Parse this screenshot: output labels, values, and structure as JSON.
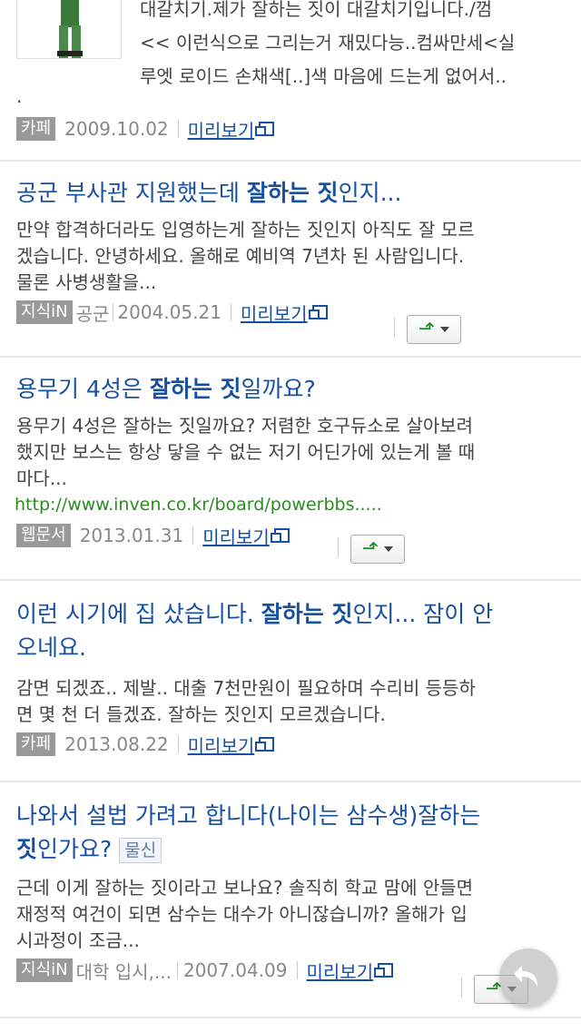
{
  "results": [
    {
      "desc_lines": [
        "대갈치기.제가 잘하는 짓이 대갈치기입니다./껌",
        "<< 이런식으로 그리는거 재밌다능..컴싸만세<실",
        "루엣 로이드 손채색[..]색 마음에 드는게 없어서.."
      ],
      "desc_tail": ".",
      "source": "카페",
      "date": "2009.10.02",
      "preview": "미리보기"
    },
    {
      "title_pre": "공군 부사관 지원했는데 ",
      "title_bold": "잘하는 짓",
      "title_post": "인지...",
      "desc_lines": [
        "만약 합격하더라도 입영하는게 잘하는 짓인지 아직도 잘 모르",
        "겠습니다. 안녕하세요. 올해로 예비역 7년차 된 사람입니다.",
        "물론 사병생활을..."
      ],
      "source": "지식iN",
      "category": "공군",
      "date": "2004.05.21",
      "preview": "미리보기"
    },
    {
      "title_pre": "용무기 4성은 ",
      "title_bold": "잘하는 짓",
      "title_post": "일까요?",
      "desc_lines": [
        "용무기 4성은 잘하는 짓일까요? 저렴한 호구듀소로 살아보려",
        "했지만 보스는 항상 닿을 수 없는 저기 어딘가에 있는게 볼 때",
        "마다..."
      ],
      "url": "http://www.inven.co.kr/board/powerbbs.....",
      "source": "웹문서",
      "date": "2013.01.31",
      "preview": "미리보기"
    },
    {
      "title_pre": "이런 시기에 집 샀습니다. ",
      "title_bold": "잘하는 짓",
      "title_post": "인지... 잠이 안",
      "title_line2": "오네요.",
      "desc_lines": [
        "감면 되겠죠.. 제발.. 대출 7천만원이 필요하며 수리비 등등하",
        "면 몇 천 더 들겠죠. 잘하는 짓인지 모르겠습니다."
      ],
      "source": "카페",
      "date": "2013.08.22",
      "preview": "미리보기"
    },
    {
      "title_line1": "나와서 설법 가려고 합니다(나이는 삼수생)잘하는",
      "title_bold2": "짓",
      "title_post2": "인가요?",
      "tag": "물신",
      "desc_lines": [
        "근데 이게 잘하는 짓이라고 보나요? 솔직히 학교 맘에 안들면",
        "재정적 여건이 되면 삼수는 대수가 아니잖습니까? 올해가 입",
        "시과정이 조금..."
      ],
      "source": "지식iN",
      "category": "대학 입시,...",
      "date": "2007.04.09",
      "preview": "미리보기"
    }
  ],
  "icons": {
    "share": "share-arrow-icon",
    "preview": "popup-window-icon",
    "fab": "back-arrow-icon"
  },
  "colors": {
    "title": "#1650a5",
    "url": "#2a8c1f",
    "badge": "#999999"
  }
}
